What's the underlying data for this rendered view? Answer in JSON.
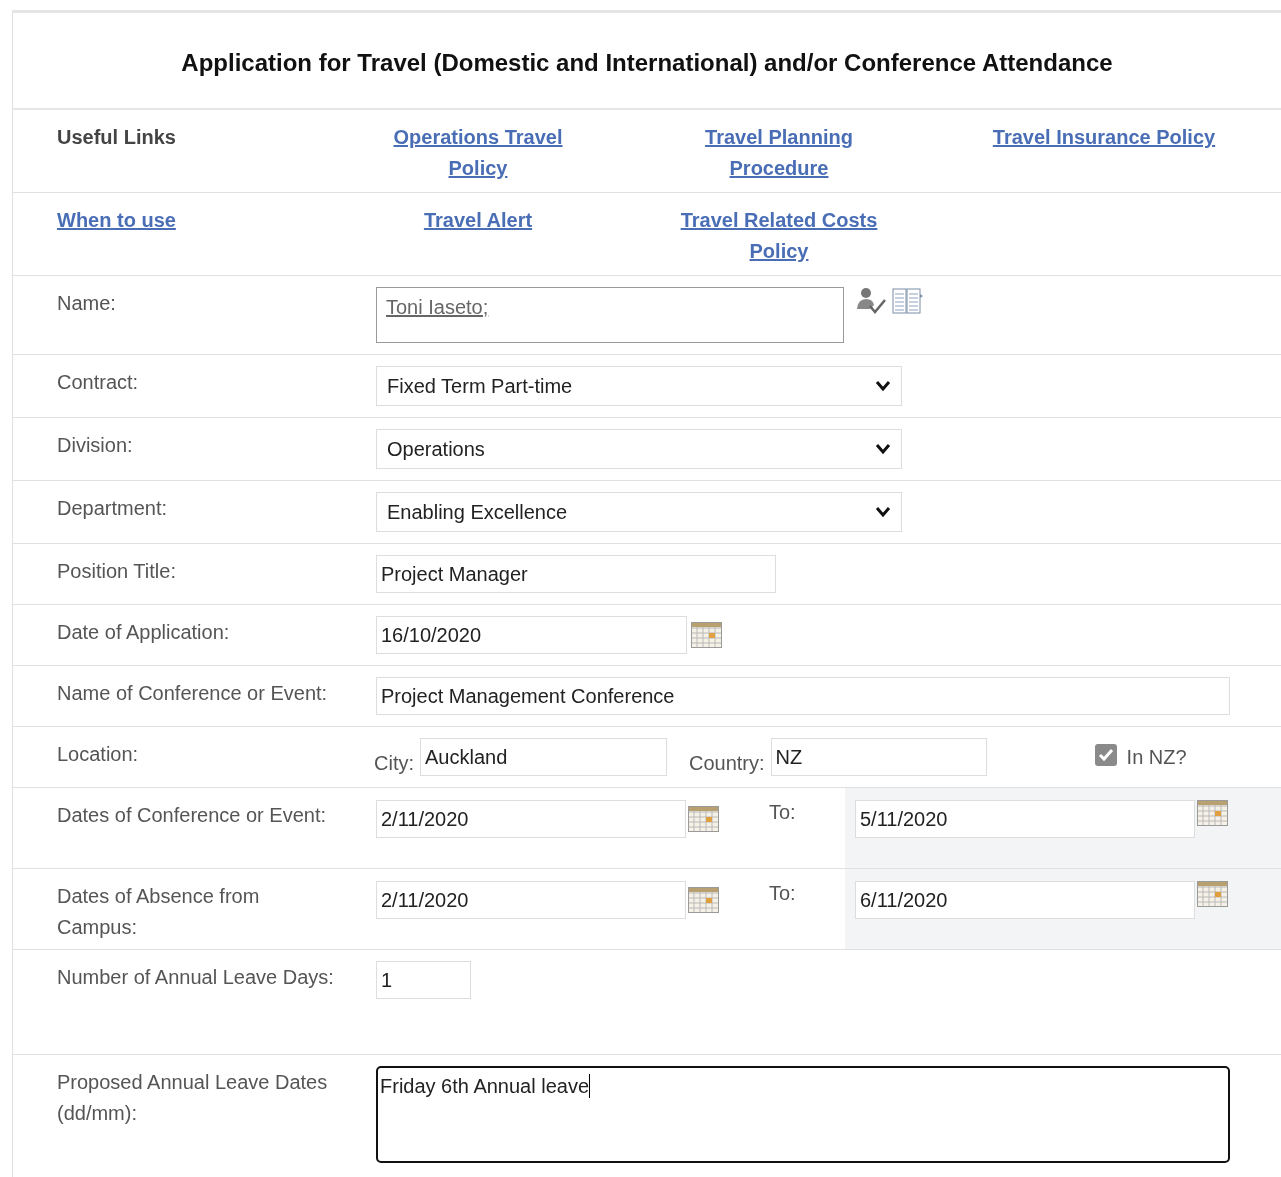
{
  "title": "Application for Travel (Domestic and International) and/or Conference Attendance",
  "useful_links": {
    "rows": [
      [
        {
          "kind": "label",
          "text": "Useful Links"
        },
        {
          "kind": "link",
          "text": "Operations Travel Policy"
        },
        {
          "kind": "link",
          "text": "Travel Planning Procedure"
        },
        {
          "kind": "link",
          "text": "Travel Insurance Policy"
        }
      ],
      [
        {
          "kind": "link",
          "text": "When to use"
        },
        {
          "kind": "link",
          "text": "Travel Alert"
        },
        {
          "kind": "link",
          "text": "Travel Related Costs Policy"
        }
      ]
    ]
  },
  "fields": [
    {
      "kind": "people",
      "label": "Name:",
      "value": "Toni Iaseto;"
    },
    {
      "kind": "select",
      "label": "Contract:",
      "value": "Fixed Term Part-time"
    },
    {
      "kind": "select",
      "label": "Division:",
      "value": "Operations"
    },
    {
      "kind": "select",
      "label": "Department:",
      "value": "Enabling Excellence"
    },
    {
      "kind": "text",
      "label": "Position Title:",
      "value": "Project Manager"
    },
    {
      "kind": "date",
      "label": "Date of Application:",
      "value": "16/10/2020"
    },
    {
      "kind": "long-text",
      "label": "Name of Conference or Event:",
      "value": "Project Management Conference"
    },
    {
      "kind": "location",
      "label": "Location:",
      "city_label": "City:",
      "city": "Auckland",
      "country_label": "Country:",
      "country": "NZ",
      "checkbox_label": "In NZ?",
      "checked": true
    },
    {
      "kind": "date-range",
      "label": "Dates of Conference or Event:",
      "from": "2/11/2020",
      "to_label": "To:",
      "to": "5/11/2020"
    },
    {
      "kind": "date-range",
      "label": "Dates of Absence from Campus:",
      "from": "2/11/2020",
      "to_label": "To:",
      "to": "6/11/2020"
    },
    {
      "kind": "number",
      "label": "Number of Annual Leave Days:",
      "value": "1"
    },
    {
      "kind": "textarea",
      "label": "Proposed Annual Leave Dates (dd/mm):",
      "value": "Friday 6th Annual leave",
      "focused": true
    }
  ]
}
